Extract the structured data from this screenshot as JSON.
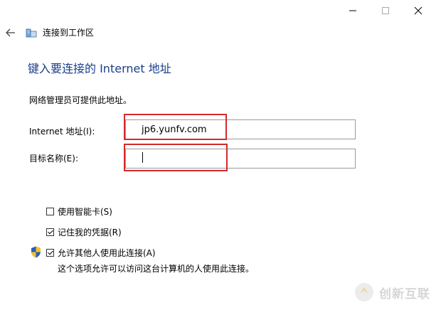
{
  "breadcrumb": {
    "title": "连接到工作区"
  },
  "heading": "键入要连接的 Internet 地址",
  "description": "网络管理员可提供此地址。",
  "address": {
    "label": "Internet 地址(I):",
    "value": "jp6.yunfv.com"
  },
  "destination": {
    "label": "目标名称(E):",
    "value": ""
  },
  "options": {
    "smartcard": {
      "label": "使用智能卡(S)",
      "checked": false
    },
    "remember": {
      "label": "记住我的凭据(R)",
      "checked": true
    },
    "allow_others": {
      "label": "允许其他人使用此连接(A)",
      "checked": true
    },
    "allow_others_note": "这个选项允许可以访问这台计算机的人使用此连接。"
  },
  "watermark": {
    "text": "创新互联",
    "icon": "watermark-logo-icon"
  },
  "icons": [
    "minimize-icon",
    "maximize-icon",
    "close-icon",
    "back-arrow-icon",
    "network-workplace-icon",
    "uac-shield-icon"
  ],
  "colors": {
    "heading": "#1a3e8c",
    "highlight": "#d22b2b"
  }
}
